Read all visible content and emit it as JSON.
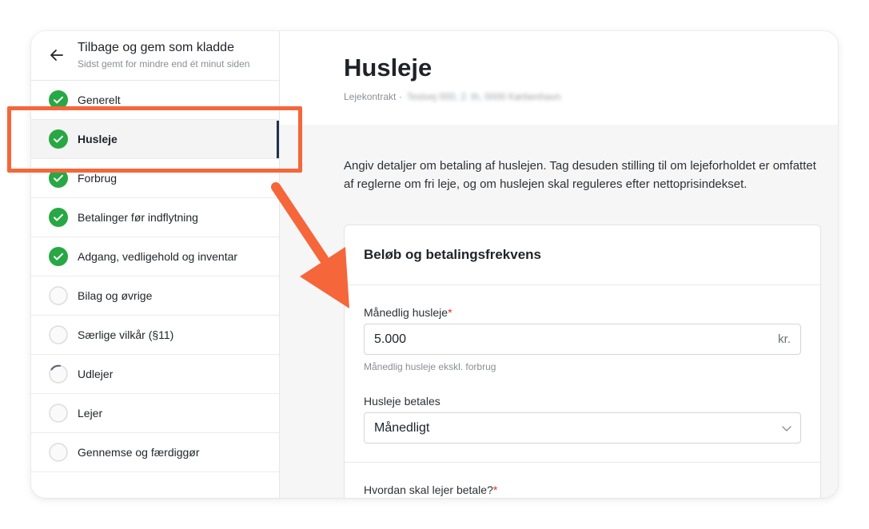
{
  "sidebar": {
    "back_title": "Tilbage og gem som kladde",
    "saved_status": "Sidst gemt for mindre end ét minut siden",
    "steps": [
      {
        "label": "Generelt",
        "status": "done"
      },
      {
        "label": "Husleje",
        "status": "done"
      },
      {
        "label": "Forbrug",
        "status": "done"
      },
      {
        "label": "Betalinger før indflytning",
        "status": "done"
      },
      {
        "label": "Adgang, vedligehold og inventar",
        "status": "done"
      },
      {
        "label": "Bilag og øvrige",
        "status": "empty"
      },
      {
        "label": "Særlige vilkår (§11)",
        "status": "empty"
      },
      {
        "label": "Udlejer",
        "status": "partial"
      },
      {
        "label": "Lejer",
        "status": "empty"
      },
      {
        "label": "Gennemse og færdiggør",
        "status": "empty"
      }
    ]
  },
  "main": {
    "title": "Husleje",
    "subtitle_prefix": "Lejekontrakt ·",
    "subtitle_blurred": "Testvej 000, 2. th, 0000 Kørbenhavn",
    "intro": "Angiv detaljer om betaling af huslejen. Tag desuden stilling til om lejeforholdet er omfattet af reglerne om fri leje, og om huslejen skal reguleres efter nettoprisindekset.",
    "panel": {
      "title": "Beløb og betalingsfrekvens",
      "rent_label": "Månedlig husleje",
      "rent_required": "*",
      "rent_value": "5.000",
      "rent_suffix": "kr.",
      "rent_help": "Månedlig husleje ekskl. forbrug",
      "frequency_label": "Husleje betales",
      "frequency_value": "Månedligt",
      "payment_label": "Hvordan skal lejer betale?",
      "payment_required": "*"
    }
  },
  "colors": {
    "done_green": "#27a844",
    "active_indicator": "#22314f",
    "annotation_orange": "#f5663b",
    "required_red": "#e0301e"
  }
}
